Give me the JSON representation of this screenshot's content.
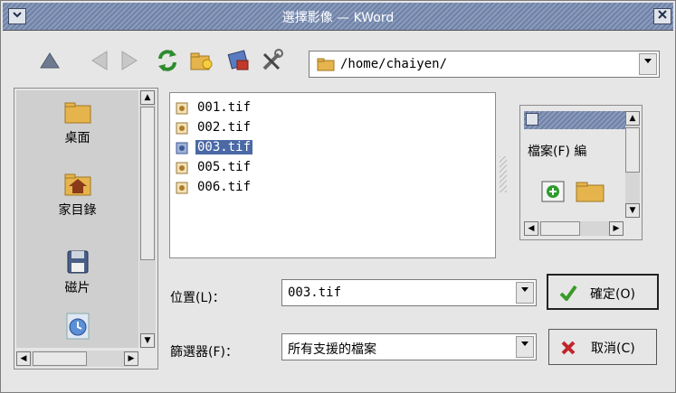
{
  "window": {
    "title": "選擇影像 — KWord",
    "menu_button": "⌄",
    "close_button": "✕"
  },
  "toolbar": {
    "icons": [
      "up-icon",
      "back-icon",
      "forward-icon",
      "reload-icon",
      "new-folder-icon",
      "properties-icon",
      "settings-icon"
    ],
    "path": "/home/chaiyen/"
  },
  "sidebar": {
    "items": [
      {
        "label": "桌面",
        "icon": "folder-icon"
      },
      {
        "label": "家目錄",
        "icon": "home-folder-icon"
      },
      {
        "label": "磁片",
        "icon": "floppy-icon"
      },
      {
        "label": "",
        "icon": "clock-icon"
      }
    ]
  },
  "files": [
    {
      "name": "001.tif",
      "selected": false
    },
    {
      "name": "002.tif",
      "selected": false
    },
    {
      "name": "003.tif",
      "selected": true
    },
    {
      "name": "005.tif",
      "selected": false
    },
    {
      "name": "006.tif",
      "selected": false
    }
  ],
  "preview": {
    "menu_text": "檔案(F) 編"
  },
  "form": {
    "location_label": "位置(L)：",
    "location_value": "003.tif",
    "filter_label": "篩選器(F)：",
    "filter_value": "所有支援的檔案"
  },
  "buttons": {
    "ok": "確定(O)",
    "cancel": "取消(C)"
  },
  "colors": {
    "selection": "#4a69a5",
    "titlebar": "#7d8fb0"
  }
}
